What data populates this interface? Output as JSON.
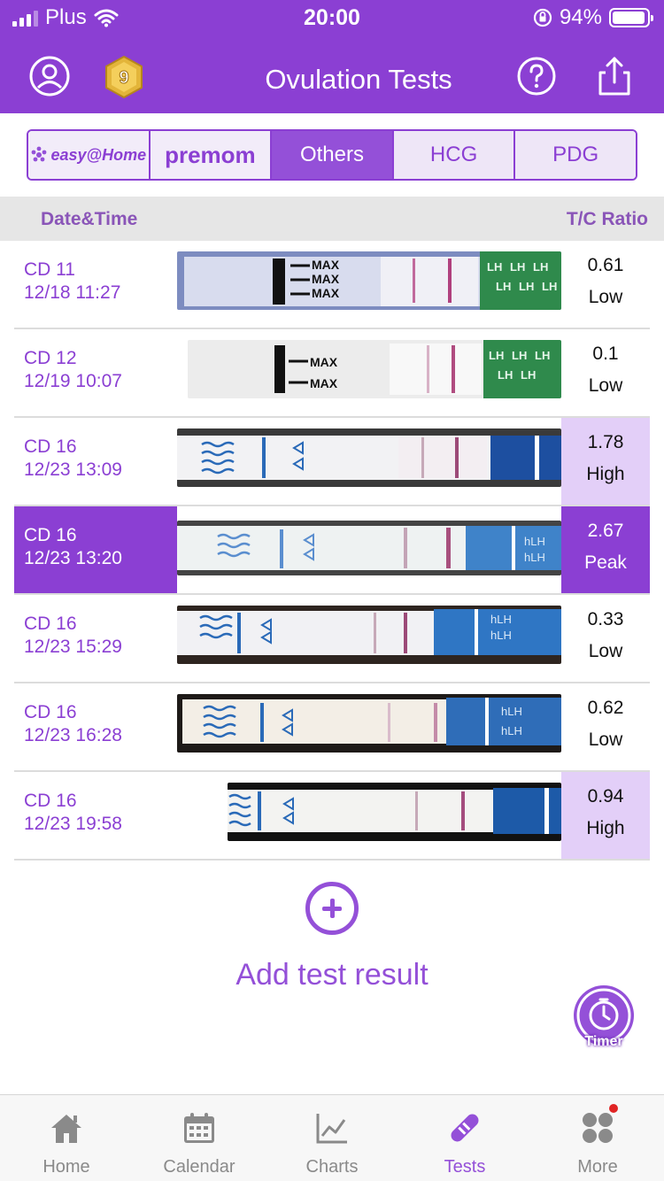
{
  "status_bar": {
    "carrier": "Plus",
    "time": "20:00",
    "battery": "94%",
    "battery_level": 0.94
  },
  "header": {
    "title": "Ovulation Tests",
    "badge_number": "9"
  },
  "segments": [
    {
      "label": "easy@Home",
      "active": false
    },
    {
      "label": "premom",
      "active": false
    },
    {
      "label": "Others",
      "active": true
    },
    {
      "label": "HCG",
      "active": false
    },
    {
      "label": "PDG",
      "active": false
    }
  ],
  "list": {
    "col_left": "Date&Time",
    "col_right": "T/C Ratio",
    "rows": [
      {
        "cd": "CD 11",
        "datetime": "12/18 11:27",
        "ratio": "0.61",
        "level": "Low"
      },
      {
        "cd": "CD 12",
        "datetime": "12/19 10:07",
        "ratio": "0.1",
        "level": "Low"
      },
      {
        "cd": "CD 16",
        "datetime": "12/23 13:09",
        "ratio": "1.78",
        "level": "High"
      },
      {
        "cd": "CD 16",
        "datetime": "12/23 13:20",
        "ratio": "2.67",
        "level": "Peak"
      },
      {
        "cd": "CD 16",
        "datetime": "12/23 15:29",
        "ratio": "0.33",
        "level": "Low"
      },
      {
        "cd": "CD 16",
        "datetime": "12/23 16:28",
        "ratio": "0.62",
        "level": "Low"
      },
      {
        "cd": "CD 16",
        "datetime": "12/23 19:58",
        "ratio": "0.94",
        "level": "High"
      }
    ]
  },
  "strip_labels": {
    "max": "MAX",
    "lh": "LH",
    "hlh": "hLH"
  },
  "add_button": {
    "label": "Add test result"
  },
  "timer": {
    "label": "Timer"
  },
  "tabbar": [
    {
      "label": "Home",
      "icon": "home-icon"
    },
    {
      "label": "Calendar",
      "icon": "calendar-icon"
    },
    {
      "label": "Charts",
      "icon": "chart-icon"
    },
    {
      "label": "Tests",
      "icon": "test-strip-icon"
    },
    {
      "label": "More",
      "icon": "more-grid-icon"
    }
  ],
  "colors": {
    "brand_purple": "#8b3fd3",
    "highlight_lavender": "#e3cff8",
    "notification_red": "#e02424"
  }
}
